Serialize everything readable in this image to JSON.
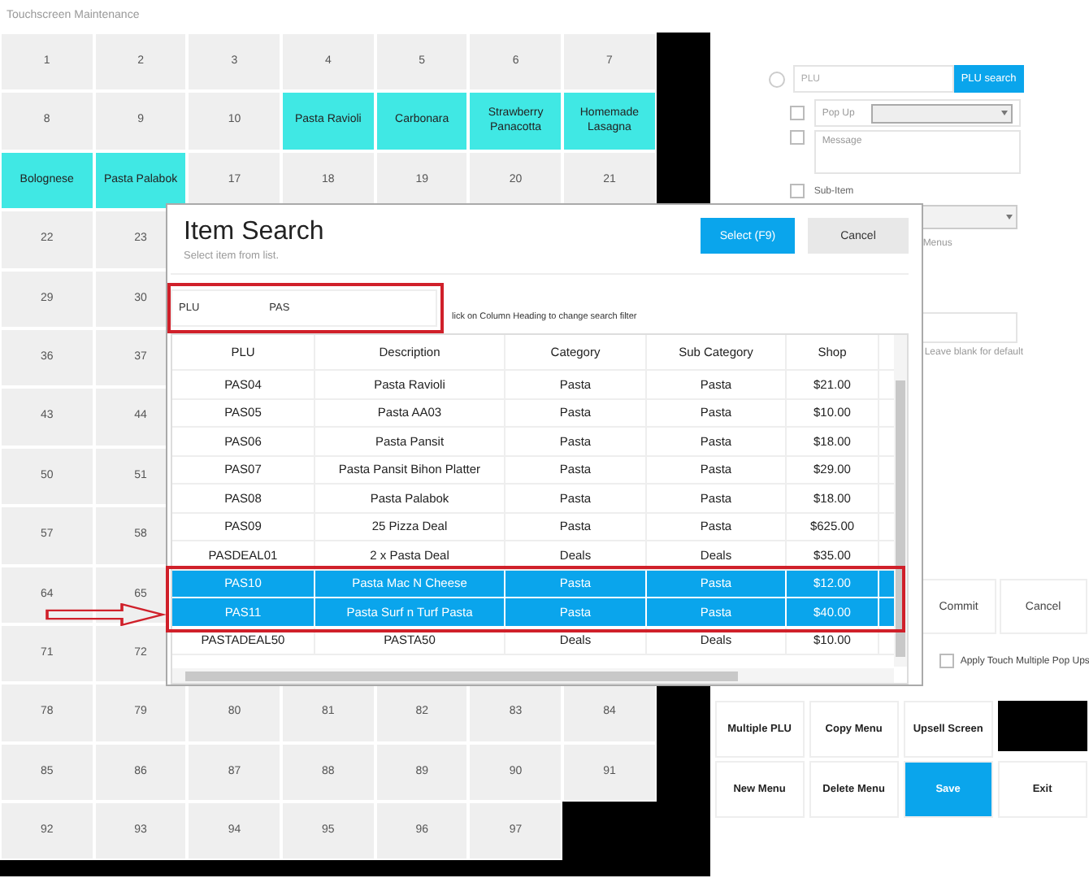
{
  "window": {
    "title": "Touchscreen Maintenance"
  },
  "button_grid": {
    "rows": [
      [
        {
          "label": "1",
          "assigned": false
        },
        {
          "label": "2",
          "assigned": false
        },
        {
          "label": "3",
          "assigned": false
        },
        {
          "label": "4",
          "assigned": false
        },
        {
          "label": "5",
          "assigned": false
        },
        {
          "label": "6",
          "assigned": false
        },
        {
          "label": "7",
          "assigned": false
        }
      ],
      [
        {
          "label": "8",
          "assigned": false
        },
        {
          "label": "9",
          "assigned": false
        },
        {
          "label": "10",
          "assigned": false
        },
        {
          "label": "Pasta Ravioli",
          "assigned": true
        },
        {
          "label": "Carbonara",
          "assigned": true
        },
        {
          "label": "Strawberry Panacotta",
          "assigned": true
        },
        {
          "label": "Homemade Lasagna",
          "assigned": true
        }
      ],
      [
        {
          "label": "Bolognese",
          "assigned": true
        },
        {
          "label": "Pasta Palabok",
          "assigned": true
        },
        {
          "label": "17",
          "assigned": false
        },
        {
          "label": "18",
          "assigned": false
        },
        {
          "label": "19",
          "assigned": false
        },
        {
          "label": "20",
          "assigned": false
        },
        {
          "label": "21",
          "assigned": false
        }
      ],
      [
        {
          "label": "22",
          "assigned": false
        },
        {
          "label": "23",
          "assigned": false
        }
      ],
      [
        {
          "label": "29",
          "assigned": false
        },
        {
          "label": "30",
          "assigned": false
        }
      ],
      [
        {
          "label": "36",
          "assigned": false
        },
        {
          "label": "37",
          "assigned": false
        }
      ],
      [
        {
          "label": "43",
          "assigned": false
        },
        {
          "label": "44",
          "assigned": false
        }
      ],
      [
        {
          "label": "50",
          "assigned": false
        },
        {
          "label": "51",
          "assigned": false
        }
      ],
      [
        {
          "label": "57",
          "assigned": false
        },
        {
          "label": "58",
          "assigned": false
        }
      ],
      [
        {
          "label": "64",
          "assigned": false
        },
        {
          "label": "65",
          "assigned": false
        }
      ],
      [
        {
          "label": "71",
          "assigned": false
        },
        {
          "label": "72",
          "assigned": false
        }
      ],
      [
        {
          "label": "78",
          "assigned": false
        },
        {
          "label": "79",
          "assigned": false
        },
        {
          "label": "80",
          "assigned": false
        },
        {
          "label": "81",
          "assigned": false
        },
        {
          "label": "82",
          "assigned": false
        },
        {
          "label": "83",
          "assigned": false
        },
        {
          "label": "84",
          "assigned": false
        }
      ],
      [
        {
          "label": "85",
          "assigned": false
        },
        {
          "label": "86",
          "assigned": false
        },
        {
          "label": "87",
          "assigned": false
        },
        {
          "label": "88",
          "assigned": false
        },
        {
          "label": "89",
          "assigned": false
        },
        {
          "label": "90",
          "assigned": false
        },
        {
          "label": "91",
          "assigned": false
        }
      ],
      [
        {
          "label": "92",
          "assigned": false
        },
        {
          "label": "93",
          "assigned": false
        },
        {
          "label": "94",
          "assigned": false
        },
        {
          "label": "95",
          "assigned": false
        },
        {
          "label": "96",
          "assigned": false
        },
        {
          "label": "97",
          "assigned": false
        }
      ]
    ]
  },
  "plu_panel": {
    "plu": {
      "placeholder": "PLU",
      "selected": false
    },
    "search_button": "PLU search",
    "options": [
      {
        "kind": "popup",
        "label": "Pop Up",
        "checked": false
      },
      {
        "kind": "message",
        "placeholder": "Message",
        "checked": false
      },
      {
        "kind": "plain",
        "label": "Sub-Item",
        "checked": false
      }
    ],
    "menus_label": "Menus",
    "default_hint": "Leave blank for default"
  },
  "actions": {
    "commit": "Commit",
    "cancel": "Cancel"
  },
  "apply_popups": {
    "label": "Apply Touch Multiple Pop Ups",
    "checked": false
  },
  "footer_buttons": [
    {
      "kind": "button",
      "label": "Multiple PLU",
      "primary": false
    },
    {
      "kind": "button",
      "label": "Copy Menu",
      "primary": false
    },
    {
      "kind": "button",
      "label": "Upsell Screen",
      "primary": false
    },
    {
      "kind": "blank"
    },
    {
      "kind": "button",
      "label": "New Menu",
      "primary": false
    },
    {
      "kind": "button",
      "label": "Delete Menu",
      "primary": false
    },
    {
      "kind": "button",
      "label": "Save",
      "primary": true
    },
    {
      "kind": "button",
      "label": "Exit",
      "primary": false
    }
  ],
  "item_search": {
    "title": "Item Search",
    "subtitle": "Select item from list.",
    "select_button": "Select (F9)",
    "cancel_button": "Cancel",
    "filter": {
      "field": "PLU",
      "value": "PAS"
    },
    "hint": "lick on Column Heading to change search filter",
    "columns": [
      "PLU",
      "Description",
      "Category",
      "Sub Category",
      "Shop"
    ],
    "rows": [
      {
        "cells": [
          "PAS04",
          "Pasta Ravioli",
          "Pasta",
          "Pasta",
          "$21.00"
        ],
        "selected": false
      },
      {
        "cells": [
          "PAS05",
          "Pasta AA03",
          "Pasta",
          "Pasta",
          "$10.00"
        ],
        "selected": false
      },
      {
        "cells": [
          "PAS06",
          "Pasta Pansit",
          "Pasta",
          "Pasta",
          "$18.00"
        ],
        "selected": false
      },
      {
        "cells": [
          "PAS07",
          "Pasta Pansit Bihon Platter",
          "Pasta",
          "Pasta",
          "$29.00"
        ],
        "selected": false
      },
      {
        "cells": [
          "PAS08",
          "Pasta Palabok",
          "Pasta",
          "Pasta",
          "$18.00"
        ],
        "selected": false
      },
      {
        "cells": [
          "PAS09",
          "25 Pizza Deal",
          "Pasta",
          "Pasta",
          "$625.00"
        ],
        "selected": false
      },
      {
        "cells": [
          "PASDEAL01",
          "2 x Pasta Deal",
          "Deals",
          "Deals",
          "$35.00"
        ],
        "selected": false
      },
      {
        "cells": [
          "PAS10",
          "Pasta Mac N Cheese",
          "Pasta",
          "Pasta",
          "$12.00"
        ],
        "selected": true
      },
      {
        "cells": [
          "PAS11",
          "Pasta Surf n Turf Pasta",
          "Pasta",
          "Pasta",
          "$40.00"
        ],
        "selected": true
      },
      {
        "cells": [
          "PASTADEAL50",
          "PASTA50",
          "Deals",
          "Deals",
          "$10.00"
        ],
        "selected": false
      }
    ]
  }
}
